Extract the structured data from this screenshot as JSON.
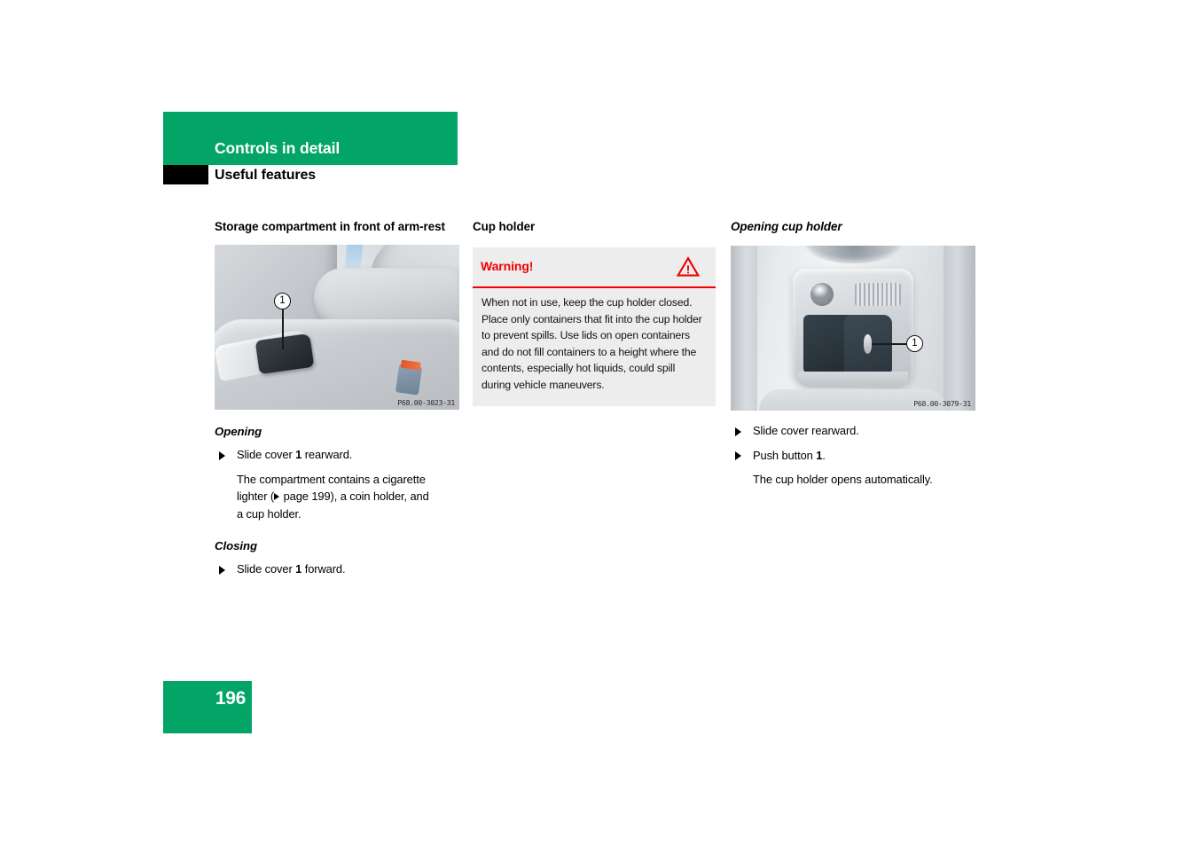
{
  "header": {
    "chapter": "Controls in detail",
    "section": "Useful features"
  },
  "columns": {
    "left": {
      "heading": "Storage compartment in front of arm-rest",
      "figure": {
        "caption": "P68.00-3023-31",
        "callout": "1"
      },
      "opening_heading": "Opening",
      "opening_step": {
        "before": "Slide cover ",
        "number": "1",
        "after": " rearward."
      },
      "opening_note": {
        "line1": "The compartment contains a cigarette",
        "line2_a": "lighter (",
        "line2_b": " page 199), a coin holder, and",
        "line3": "a cup holder."
      },
      "closing_heading": "Closing",
      "closing_step": {
        "before": "Slide cover ",
        "number": "1",
        "after": " forward."
      }
    },
    "middle": {
      "heading": "Cup holder",
      "warning": {
        "label": "Warning!",
        "icon": "warning-triangle-icon",
        "body": "When not in use, keep the cup holder closed. Place only containers that fit into the cup holder to prevent spills. Use lids on open containers and do not fill containers to a height where the contents, especially hot liquids, could spill during vehicle maneuvers."
      }
    },
    "right": {
      "heading": "Opening cup holder",
      "figure": {
        "caption": "P68.00-3079-31",
        "callout": "1"
      },
      "step1": "Slide cover rearward.",
      "step2": {
        "before": "Push button ",
        "number": "1",
        "after": "."
      },
      "note": "The cup holder opens automatically."
    }
  },
  "footer": {
    "page_number": "196"
  },
  "colors": {
    "brand_green": "#02a566",
    "warning_red": "#f20000",
    "warning_bg": "#ededed",
    "marker_black": "#000000"
  }
}
